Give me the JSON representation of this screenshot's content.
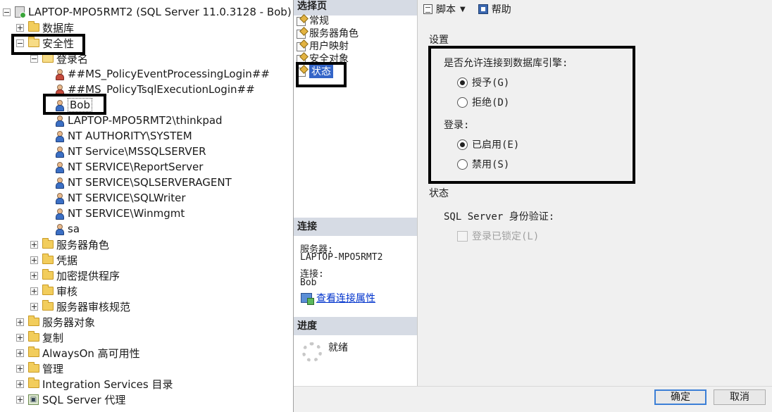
{
  "tree": {
    "server": "LAPTOP-MPO5RMT2 (SQL Server 11.0.3128 - Bob)",
    "databases": "数据库",
    "security": "安全性",
    "logins_folder": "登录名",
    "logins": [
      "##MS_PolicyEventProcessingLogin##",
      "##MS_PolicyTsqlExecutionLogin##",
      "Bob",
      "LAPTOP-MPO5RMT2\\thinkpad",
      "NT AUTHORITY\\SYSTEM",
      "NT Service\\MSSQLSERVER",
      "NT SERVICE\\ReportServer",
      "NT SERVICE\\SQLSERVERAGENT",
      "NT SERVICE\\SQLWriter",
      "NT SERVICE\\Winmgmt",
      "sa"
    ],
    "security_children": [
      "服务器角色",
      "凭据",
      "加密提供程序",
      "审核",
      "服务器审核规范"
    ],
    "root_children": [
      "服务器对象",
      "复制",
      "AlwaysOn 高可用性",
      "管理",
      "Integration Services 目录"
    ],
    "agent": "SQL Server 代理"
  },
  "dialog": {
    "select_page_header": "选择页",
    "pages": [
      "常规",
      "服务器角色",
      "用户映射",
      "安全对象",
      "状态"
    ],
    "active_page": "状态",
    "connection_header": "连接",
    "server_label": "服务器:",
    "server_value": "LAPTOP-MPO5RMT2",
    "connection_label": "连接:",
    "connection_value": "Bob",
    "view_connection_link": "查看连接属性",
    "progress_header": "进度",
    "progress_status": "就绪",
    "toolbar": {
      "script": "脚本",
      "help": "帮助"
    },
    "settings_title": "设置",
    "permission_question": "是否允许连接到数据库引擎:",
    "grant": "授予(G)",
    "deny": "拒绝(D)",
    "permission_selected": "grant",
    "login_label": "登录:",
    "enabled": "已启用(E)",
    "disabled": "禁用(S)",
    "login_selected": "enabled",
    "status_title": "状态",
    "auth_label": "SQL Server 身份验证:",
    "locked_out": "登录已锁定(L)",
    "ok": "确定",
    "cancel": "取消"
  }
}
